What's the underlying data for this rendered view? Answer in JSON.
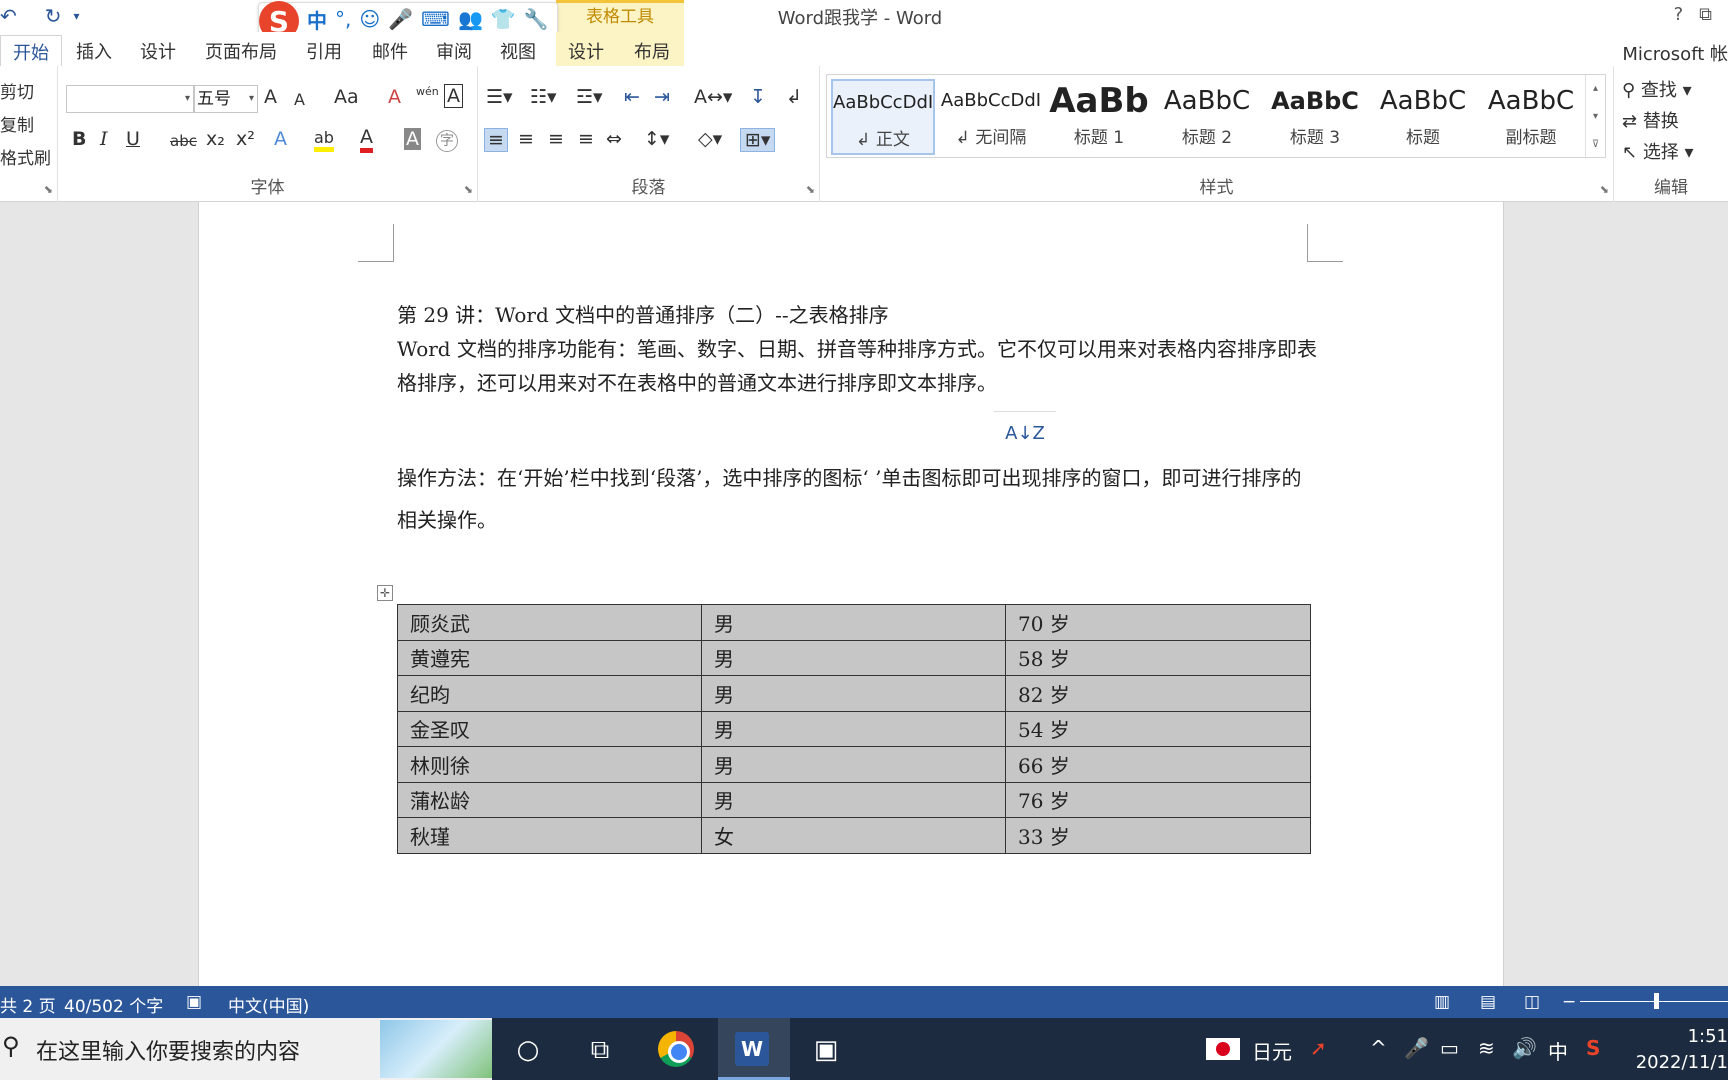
{
  "title_bar": {
    "document_title": "Word跟我学 - Word",
    "context_tab_group": "表格工具",
    "help": "?",
    "quick_access": [
      "↶",
      "↻",
      "▾"
    ]
  },
  "ime_toolbar": {
    "logo": "S",
    "mode": "中",
    "punct": "°,",
    "icons": [
      "☺",
      "🎤",
      "⌨",
      "👥",
      "👕",
      "🔧"
    ]
  },
  "tabs": [
    "开始",
    "插入",
    "设计",
    "页面布局",
    "引用",
    "邮件",
    "审阅",
    "视图",
    "设计",
    "布局"
  ],
  "account": "Microsoft 帐",
  "ribbon": {
    "clipboard": {
      "cut": "剪切",
      "copy": "复制",
      "format_painter": "格式刷"
    },
    "font": {
      "label": "字体",
      "font_name": "",
      "font_size": "五号",
      "row1_buttons": [
        "A",
        "A",
        "Aa",
        "A",
        "wén",
        "A"
      ],
      "row2_buttons": [
        "B",
        "I",
        "U",
        "abc",
        "x₂",
        "x²",
        "A",
        "ab",
        "A",
        "A",
        "字"
      ]
    },
    "paragraph": {
      "label": "段落"
    },
    "styles": {
      "label": "样式",
      "items": [
        {
          "preview": "AaBbCcDdI",
          "name": "↲ 正文"
        },
        {
          "preview": "AaBbCcDdI",
          "name": "↲ 无间隔"
        },
        {
          "preview": "AaBb",
          "name": "标题 1"
        },
        {
          "preview": "AaBbC",
          "name": "标题 2"
        },
        {
          "preview": "AaBbC",
          "name": "标题 3"
        },
        {
          "preview": "AaBbC",
          "name": "标题"
        },
        {
          "preview": "AaBbC",
          "name": "副标题"
        }
      ]
    },
    "editing": {
      "label": "编辑",
      "find": "查找",
      "replace": "替换",
      "select": "选择"
    }
  },
  "document": {
    "heading": "第 29 讲：Word 文档中的普通排序（二）--之表格排序",
    "para1": "Word 文档的排序功能有：笔画、数字、日期、拼音等种排序方式。它不仅可以用来对表格内容排序即表格排序，还可以用来对不在表格中的普通文本进行排序即文本排序。",
    "para2": "操作方法：在‘开始’栏中找到‘段落’，选中排序的图标‘          ’单击图标即可出现排序的窗口，即可进行排序的相关操作。",
    "table": [
      [
        "顾炎武",
        "男",
        "70 岁"
      ],
      [
        "黄遵宪",
        "男",
        "58 岁"
      ],
      [
        "纪昀",
        "男",
        "82 岁"
      ],
      [
        "金圣叹",
        "男",
        "54 岁"
      ],
      [
        "林则徐",
        "男",
        "66 岁"
      ],
      [
        "蒲松龄",
        "男",
        "76 岁"
      ],
      [
        "秋瑾",
        "女",
        "33 岁"
      ]
    ]
  },
  "status_bar": {
    "page": "共 2 页",
    "words": "40/502 个字",
    "language": "中文(中国)"
  },
  "taskbar": {
    "search_placeholder": "在这里输入你要搜索的内容",
    "ime_state": "日元",
    "lang": "中",
    "time": "1:51",
    "date": "2022/11/1"
  }
}
